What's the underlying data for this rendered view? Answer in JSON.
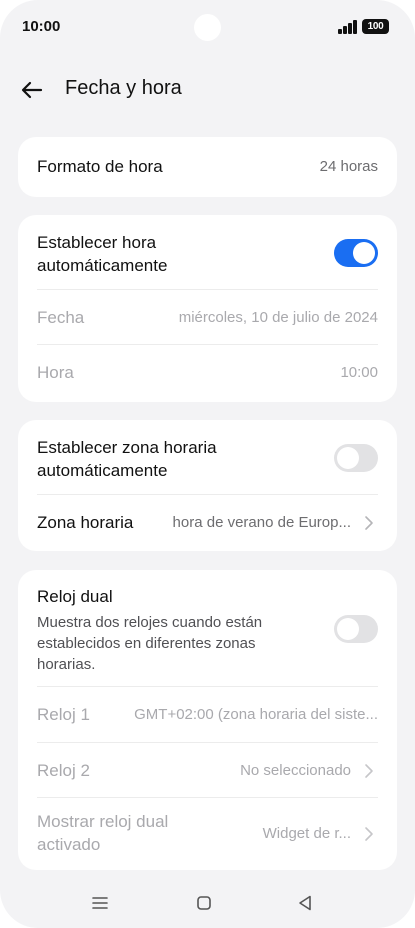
{
  "status": {
    "time": "10:00",
    "battery": "100"
  },
  "header": {
    "title": "Fecha y hora"
  },
  "time_format": {
    "label": "Formato de hora",
    "value": "24 horas"
  },
  "auto_time": {
    "label_line1": "Establecer hora",
    "label_line2": "automáticamente",
    "enabled": true,
    "date_label": "Fecha",
    "date_value": "miércoles, 10 de julio de 2024",
    "time_label": "Hora",
    "time_value": "10:00"
  },
  "auto_zone": {
    "label_line1": "Establecer zona horaria",
    "label_line2": "automáticamente",
    "enabled": false,
    "zone_label": "Zona horaria",
    "zone_value": "hora de verano de Europ..."
  },
  "dual_clock": {
    "title": "Reloj dual",
    "desc_line1": "Muestra dos relojes cuando están",
    "desc_line2": "establecidos en diferentes zonas",
    "desc_line3": "horarias.",
    "enabled": false,
    "clock1_label": "Reloj 1",
    "clock1_value": "GMT+02:00 (zona horaria del siste...",
    "clock2_label": "Reloj 2",
    "clock2_value": "No seleccionado",
    "show_label_line1": "Mostrar reloj dual",
    "show_label_line2": "activado",
    "show_value": "Widget de r..."
  },
  "icons": {
    "back": "arrow-left-icon",
    "chevron": "chevron-right-icon",
    "nav_menu": "menu-icon",
    "nav_home": "home-square-icon",
    "nav_back": "back-triangle-icon"
  },
  "colors": {
    "accent": "#1a6ef2",
    "background": "#f3f3f5",
    "card": "#ffffff"
  }
}
